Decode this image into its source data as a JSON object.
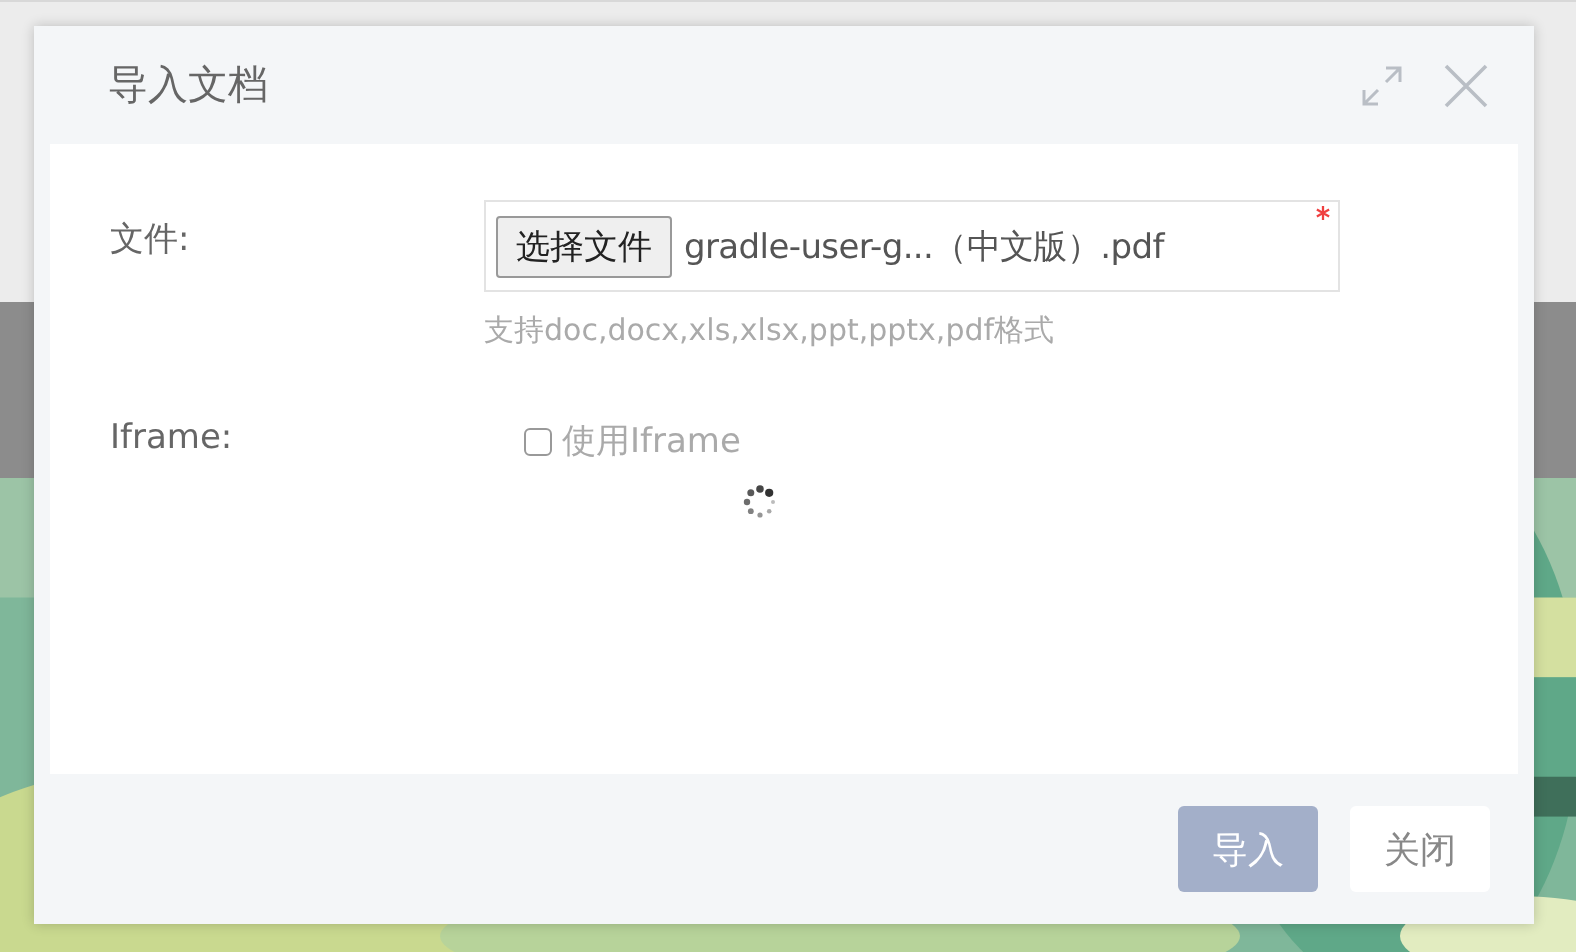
{
  "dialog": {
    "title": "导入文档",
    "fields": [
      {
        "kind": "file",
        "label": "文件:",
        "button": "选择文件",
        "value": "gradle-user-g...（中文版）.pdf",
        "required": true,
        "hint": "支持doc,docx,xls,xlsx,ppt,pptx,pdf格式"
      },
      {
        "kind": "checkbox",
        "label": "Iframe:",
        "option": "使用Iframe",
        "checked": false,
        "disabled": true
      }
    ],
    "loading": true,
    "buttons": [
      {
        "label": "导入",
        "kind": "primary"
      },
      {
        "label": "关闭",
        "kind": "default"
      }
    ]
  }
}
